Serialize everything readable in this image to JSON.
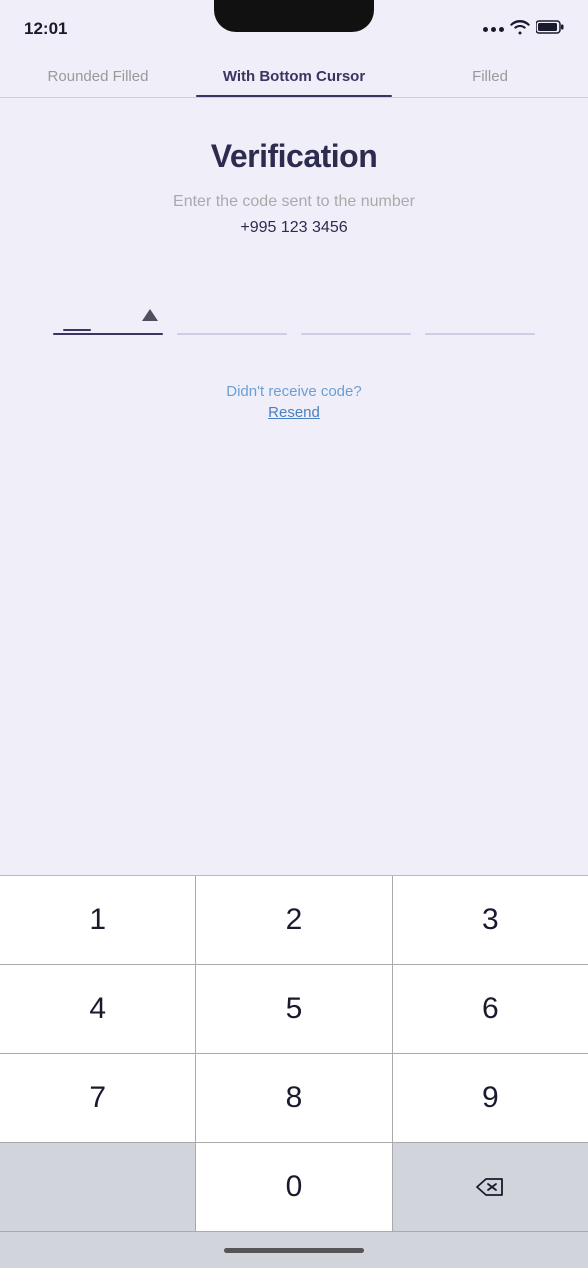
{
  "statusBar": {
    "time": "12:01"
  },
  "tabs": {
    "items": [
      {
        "id": "rounded-filled",
        "label": "Rounded Filled",
        "active": false
      },
      {
        "id": "with-bottom-cursor",
        "label": "With Bottom Cursor",
        "active": true
      },
      {
        "id": "filled",
        "label": "Filled",
        "active": false
      }
    ],
    "activeIndex": 1
  },
  "content": {
    "title": "Verification",
    "subtitle": "Enter the code sent to the number",
    "phoneNumber": "+995 123 3456"
  },
  "resend": {
    "didntReceive": "Didn't receive code?",
    "resendLabel": "Resend"
  },
  "numpad": {
    "rows": [
      [
        "1",
        "2",
        "3"
      ],
      [
        "4",
        "5",
        "6"
      ],
      [
        "7",
        "8",
        "9"
      ],
      [
        "",
        "0",
        "⌫"
      ]
    ]
  },
  "homeIndicator": {}
}
